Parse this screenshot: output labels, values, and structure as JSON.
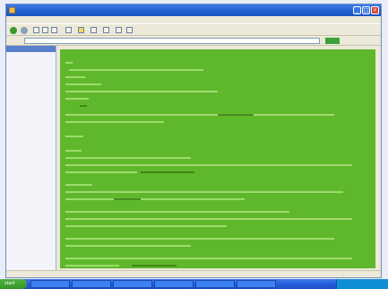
{
  "window": {
    "title": "",
    "controls": {
      "minimize": "_",
      "maximize": "□",
      "close": "×"
    }
  },
  "menu": {
    "items": [
      "",
      "",
      "",
      "",
      "",
      ""
    ]
  },
  "address": {
    "label": "",
    "value": "",
    "go": ""
  },
  "sidebar": {
    "header": "",
    "items": [
      "",
      "",
      "",
      "",
      "",
      "",
      ""
    ]
  },
  "content": {
    "tabs": [
      "",
      "",
      "",
      "",
      ""
    ]
  },
  "status": {
    "text": "",
    "zone": ""
  },
  "taskbar": {
    "start": "start",
    "items": [
      "",
      "",
      "",
      "",
      "",
      ""
    ],
    "clock": ""
  },
  "colors": {
    "content_bg": "#5fb82c",
    "titlebar": "#1f5fd1",
    "taskbar": "#245edb"
  }
}
